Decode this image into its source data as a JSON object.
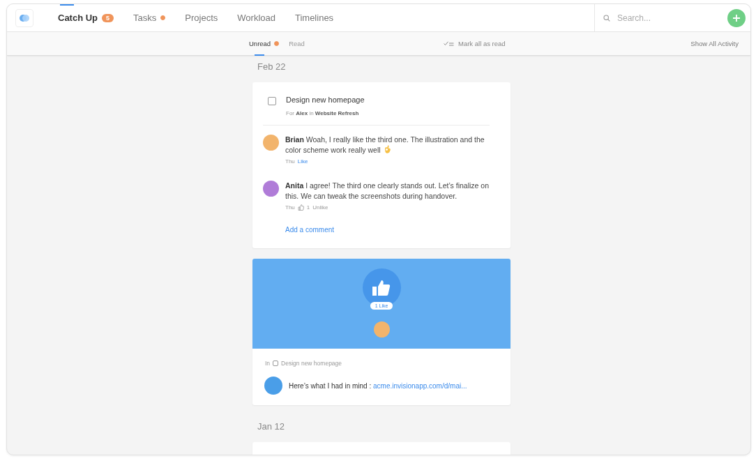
{
  "nav": {
    "tabs": [
      {
        "label": "Catch Up",
        "selected": true,
        "badge": "5",
        "dot": false
      },
      {
        "label": "Tasks",
        "selected": false,
        "dot": true
      },
      {
        "label": "Projects",
        "selected": false,
        "dot": false
      },
      {
        "label": "Workload",
        "selected": false,
        "dot": false
      },
      {
        "label": "Timelines",
        "selected": false,
        "dot": false
      }
    ],
    "search": {
      "placeholder": "Search..."
    }
  },
  "subbar": {
    "filters": [
      {
        "label": "Unread",
        "selected": true,
        "dot": true
      },
      {
        "label": "Read",
        "selected": false,
        "dot": false
      }
    ],
    "mark_all": "Mark all as read",
    "show_all": "Show All Activity"
  },
  "groups": [
    {
      "date": "Feb 22",
      "cards": [
        {
          "kind": "task",
          "task": {
            "title": "Design new homepage",
            "checked": false,
            "for_label": "For",
            "assignee": "Alex",
            "in_label": "in",
            "project": "Website Refresh"
          },
          "comments": [
            {
              "author": "Brian",
              "text": "Woah, I really like the third one. The illustration and the color scheme work really well",
              "emoji": true,
              "time": "Thu",
              "action": "Like"
            },
            {
              "author": "Anita",
              "text": "I agree! The third one clearly stands out. Let’s finalize on this. We can tweak the screenshots during handover.",
              "emoji": false,
              "time": "Thu",
              "action": "Unlike",
              "likes": "1"
            }
          ],
          "add_comment": "Add a comment"
        },
        {
          "kind": "like",
          "like_count": "1 Like",
          "in_label": "In",
          "task_title": "Design new homepage",
          "message": "Here’s what I had in mind :",
          "link": "acme.invisionapp.com/d/mai..."
        }
      ]
    },
    {
      "date": "Jan 12"
    }
  ]
}
